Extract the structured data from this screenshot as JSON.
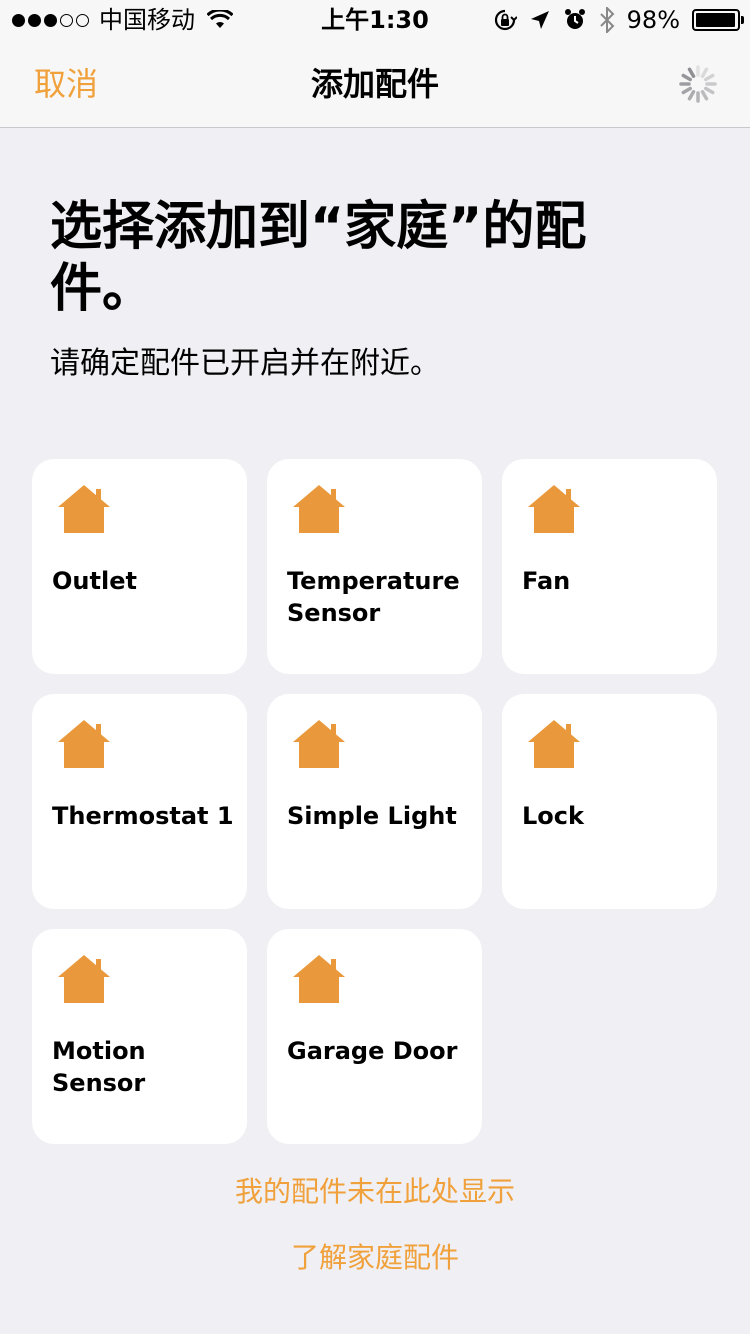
{
  "status_bar": {
    "carrier": "中国移动",
    "time": "上午1:30",
    "battery_percent": "98%",
    "battery_level": 0.98,
    "icons": [
      "signal-icon",
      "wifi-icon",
      "rotation-lock-icon",
      "location-icon",
      "alarm-icon",
      "bluetooth-icon",
      "battery-icon"
    ]
  },
  "nav": {
    "cancel_label": "取消",
    "title": "添加配件",
    "activity_icon": "spinner-icon"
  },
  "heading": {
    "title": "选择添加到“家庭”的配件。",
    "subtitle": "请确定配件已开启并在附近。"
  },
  "accessories": [
    {
      "label": "Outlet",
      "icon": "house-icon"
    },
    {
      "label": "Temperature Sensor",
      "icon": "house-icon"
    },
    {
      "label": "Fan",
      "icon": "house-icon"
    },
    {
      "label": "Thermostat 1",
      "icon": "house-icon"
    },
    {
      "label": "Simple Light",
      "icon": "house-icon"
    },
    {
      "label": "Lock",
      "icon": "house-icon"
    },
    {
      "label": "Motion Sensor",
      "icon": "house-icon"
    },
    {
      "label": "Garage Door",
      "icon": "house-icon"
    }
  ],
  "links": {
    "not_shown": "我的配件未在此处显示",
    "learn_more": "了解家庭配件"
  },
  "colors": {
    "accent": "#f0a13b",
    "house_icon": "#e9993c",
    "background": "#efeff4",
    "tile": "#ffffff"
  }
}
